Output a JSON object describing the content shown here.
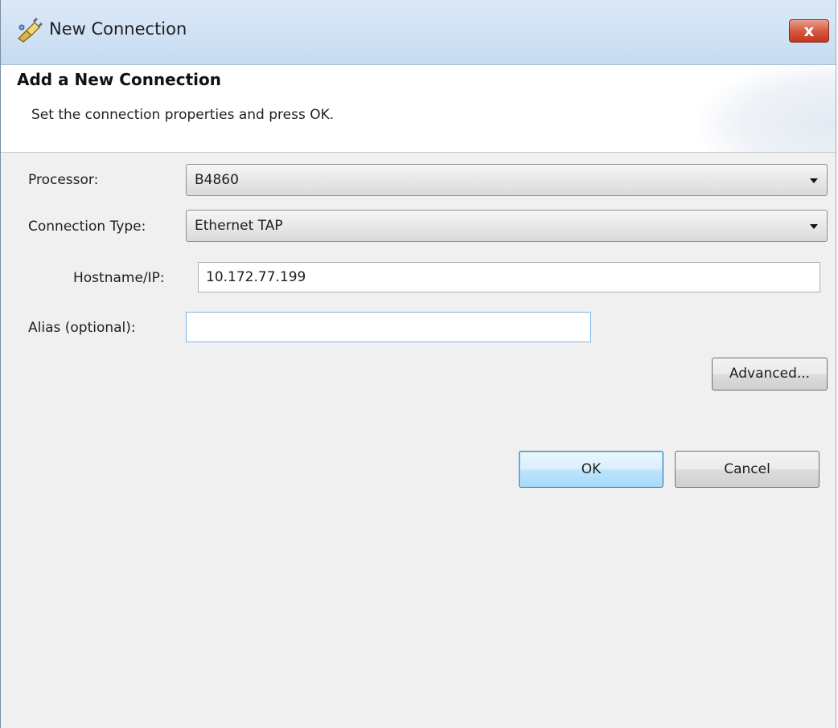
{
  "window": {
    "title": "New Connection",
    "close_label": "x"
  },
  "banner": {
    "title": "Add a New Connection",
    "description": "Set the connection properties and press OK."
  },
  "form": {
    "processor": {
      "label": "Processor:",
      "value": "B4860"
    },
    "connection_type": {
      "label": "Connection Type:",
      "value": "Ethernet TAP"
    },
    "hostname": {
      "label": "Hostname/IP:",
      "value": "10.172.77.199",
      "placeholder": ""
    },
    "alias": {
      "label": "Alias (optional):",
      "value": "",
      "placeholder": ""
    },
    "advanced_label": "Advanced..."
  },
  "buttons": {
    "ok_label": "OK",
    "cancel_label": "Cancel"
  },
  "colors": {
    "titlebar": "#d2e3f5",
    "close_button": "#c3371c",
    "dialog_background": "#f0f0f0",
    "default_button": "#bee6fd"
  },
  "icons": {
    "app": "connection-plug-icon",
    "close": "close-icon",
    "dropdown": "chevron-down-icon"
  }
}
